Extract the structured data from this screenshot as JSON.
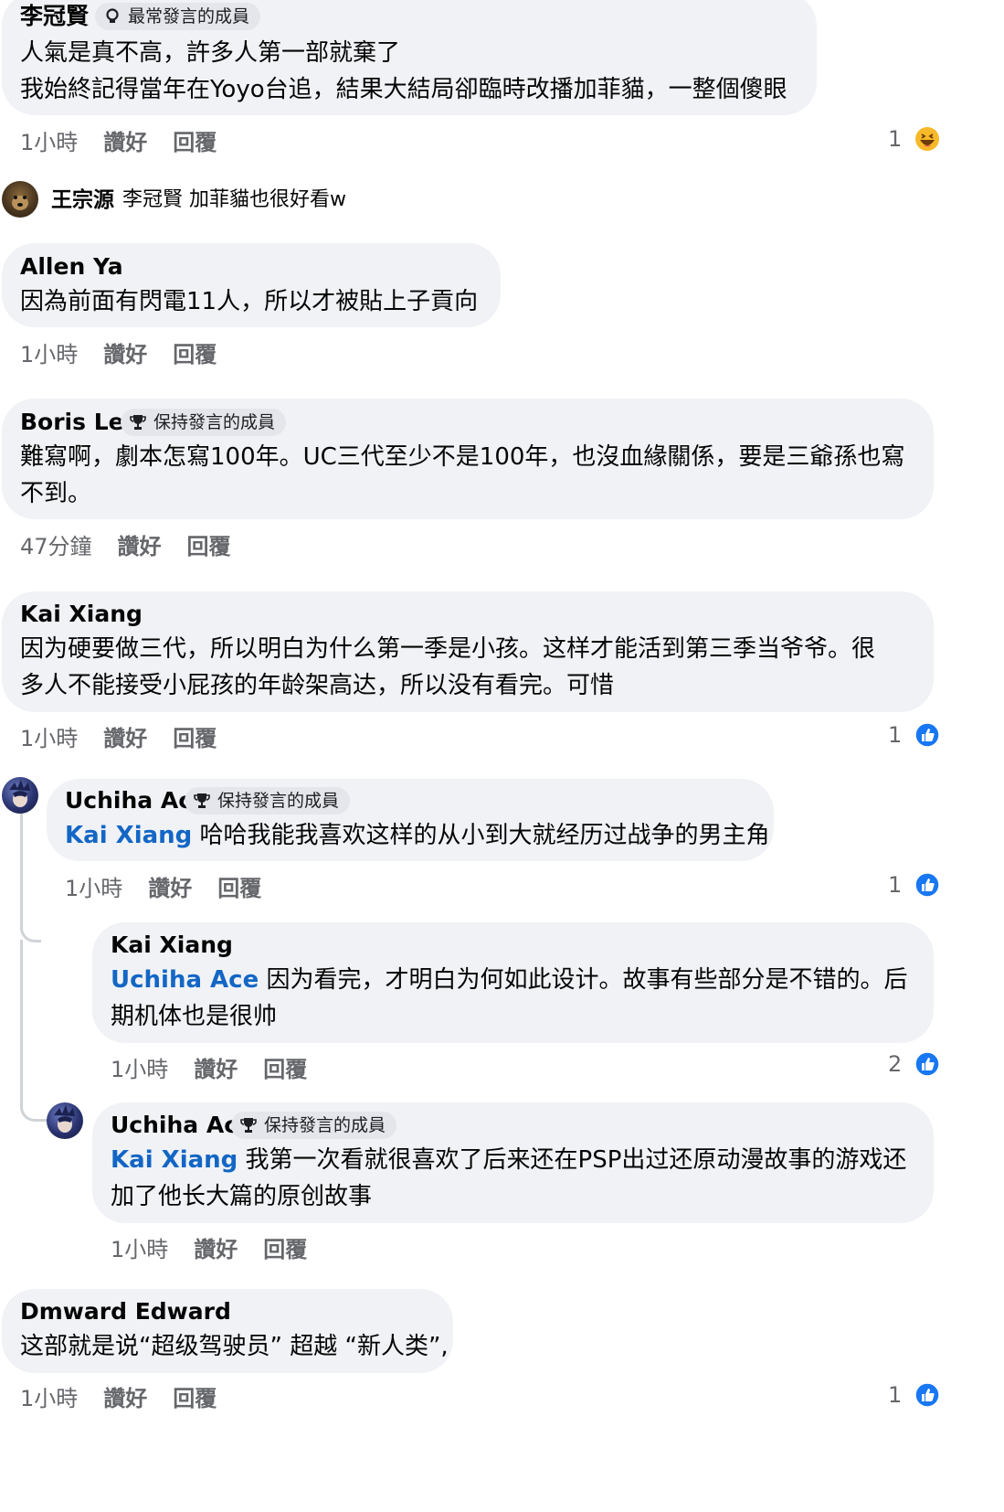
{
  "comments": [
    {
      "author": "李冠賢",
      "badge": "最常發言的成員",
      "lines": [
        "人氣是真不高，許多人第一部就棄了",
        "我始終記得當年在Yoyo台追，結果大結局卻臨時改播加菲貓，一整個傻眼"
      ],
      "time": "1小時",
      "like": "讚好",
      "reply": "回覆",
      "reaction_count": "1",
      "reaction": "haha-emoji"
    },
    {
      "author": "王宗源",
      "mention": "李冠賢",
      "text": "加菲貓也很好看w"
    },
    {
      "author": "Allen Ya",
      "lines": [
        "因為前面有閃電11人，所以才被貼上子貢向"
      ],
      "time": "1小時",
      "like": "讚好",
      "reply": "回覆"
    },
    {
      "author": "Boris Lee",
      "badge": "保持發言的成員",
      "lines": [
        "難寫啊，劇本怎寫100年。UC三代至少不是100年，也沒血緣關係，要是三爺孫也寫",
        "不到。"
      ],
      "time": "47分鐘",
      "like": "讚好",
      "reply": "回覆"
    },
    {
      "author": "Kai Xiang",
      "lines": [
        "因为硬要做三代，所以明白为什么第一季是小孩。这样才能活到第三季当爷爷。很",
        "多人不能接受小屁孩的年龄架高达，所以没有看完。可惜"
      ],
      "time": "1小時",
      "like": "讚好",
      "reply": "回覆",
      "reaction_count": "1",
      "reaction": "like"
    },
    {
      "author": "Uchiha Ace",
      "badge": "保持發言的成員",
      "mention": "Kai Xiang",
      "lines": [
        " 哈哈我能我喜欢这样的从小到大就经历过战争的男主角"
      ],
      "time": "1小時",
      "like": "讚好",
      "reply": "回覆",
      "reaction_count": "1",
      "reaction": "like"
    },
    {
      "author": "Kai Xiang",
      "mention": "Uchiha Ace",
      "lines": [
        " 因为看完，才明白为何如此设计。故事有些部分是不错的。后",
        "期机体也是很帅"
      ],
      "time": "1小時",
      "like": "讚好",
      "reply": "回覆",
      "reaction_count": "2",
      "reaction": "like"
    },
    {
      "author": "Uchiha Ace",
      "badge": "保持發言的成員",
      "mention": "Kai Xiang",
      "lines": [
        " 我第一次看就很喜欢了后来还在PSP出过还原动漫故事的游戏还",
        "加了他长大篇的原创故事"
      ],
      "time": "1小時",
      "like": "讚好",
      "reply": "回覆"
    },
    {
      "author": "Dmward Edward",
      "lines": [
        "这部就是说“超级驾驶员” 超越 “新人类”,"
      ],
      "time": "1小時",
      "like": "讚好",
      "reply": "回覆",
      "reaction_count": "1",
      "reaction": "like"
    }
  ],
  "colors": {
    "bubble": "#f0f2f5",
    "mention": "#1366c5",
    "meta": "#65676b",
    "like": "#1877f2"
  }
}
